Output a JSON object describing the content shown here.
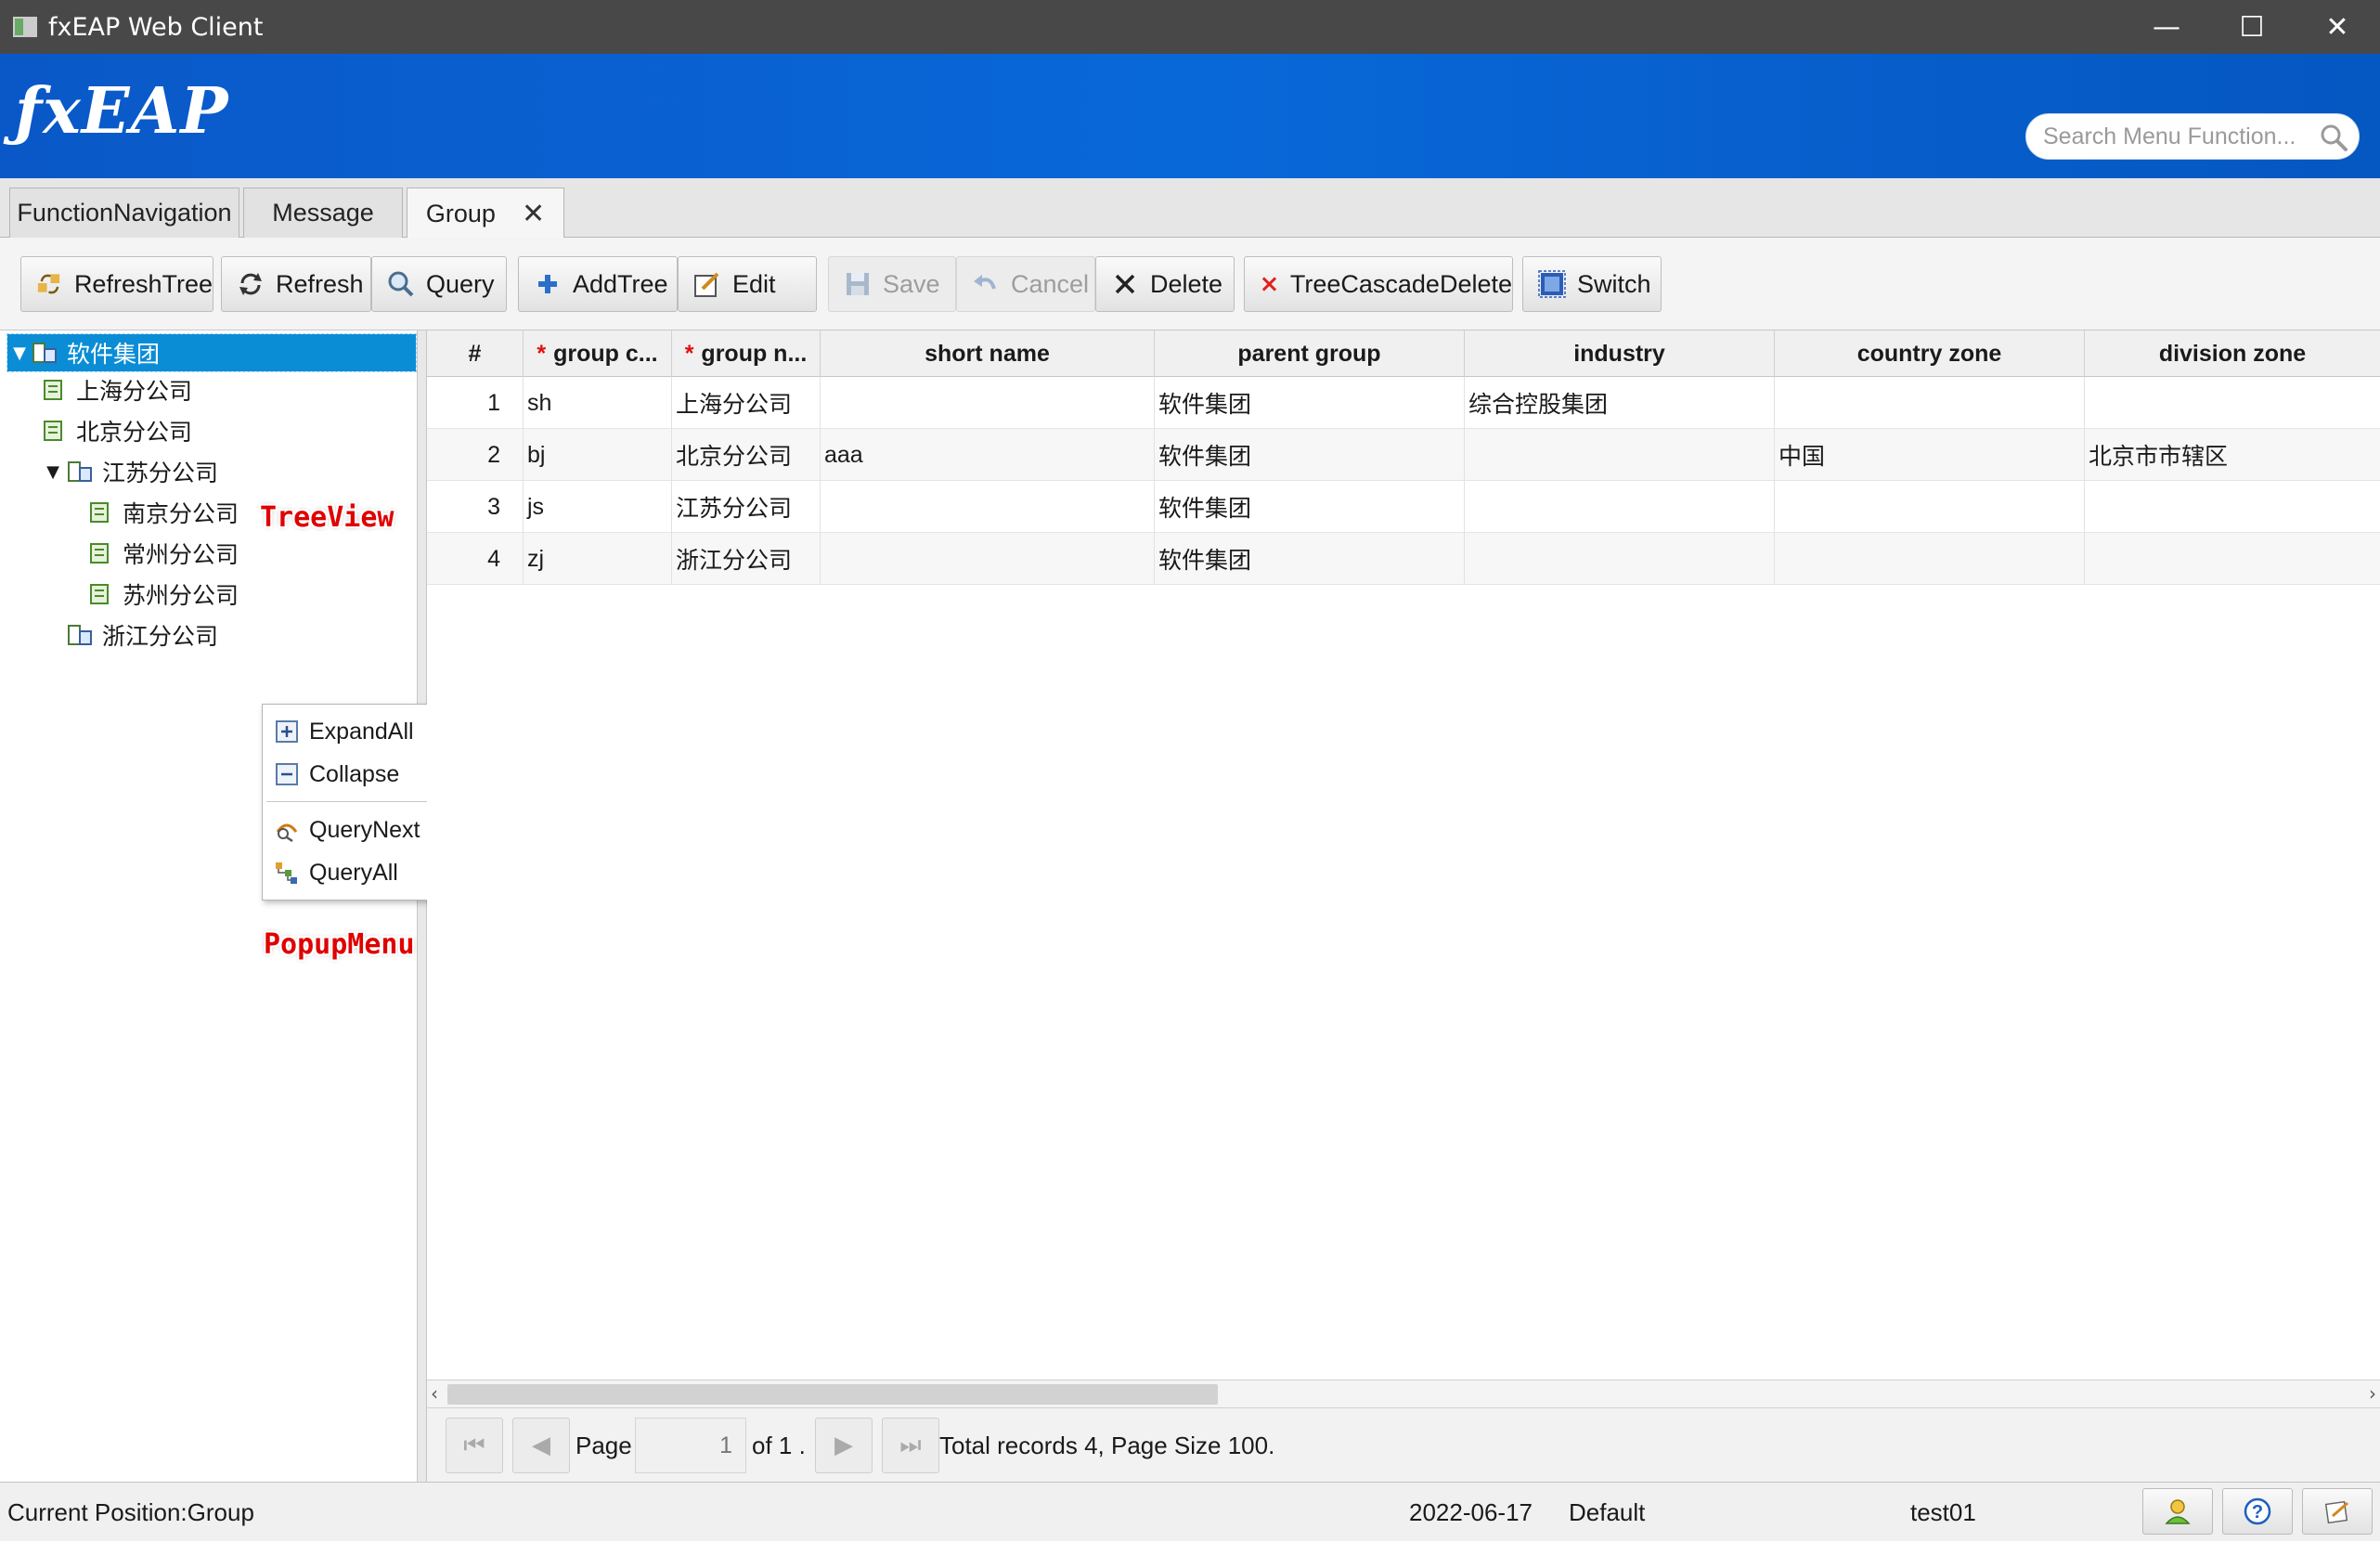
{
  "window": {
    "title": "fxEAP Web Client",
    "controls": [
      "—",
      "☐",
      "✕"
    ]
  },
  "header": {
    "logo": "ƒxEAP",
    "search": {
      "placeholder": "Search Menu Function...",
      "value": ""
    }
  },
  "tabs": [
    {
      "label": "FunctionNavigation"
    },
    {
      "label": "Message"
    },
    {
      "label": "Group",
      "active": true,
      "closable": true
    }
  ],
  "toolbar": {
    "refresh_tree": "RefreshTree",
    "refresh": "Refresh",
    "query": "Query",
    "add_tree": "AddTree",
    "edit": "Edit",
    "save": "Save",
    "cancel": "Cancel",
    "delete": "Delete",
    "tree_cascade_delete": "TreeCascadeDelete",
    "switch": "Switch"
  },
  "tree": {
    "nodes": [
      {
        "label": "软件集团",
        "level": 0,
        "expanded": true,
        "selected": true
      },
      {
        "label": "上海分公司",
        "level": 1
      },
      {
        "label": "北京分公司",
        "level": 1
      },
      {
        "label": "江苏分公司",
        "level": 1,
        "expanded": true
      },
      {
        "label": "南京分公司",
        "level": 2
      },
      {
        "label": "常州分公司",
        "level": 2
      },
      {
        "label": "苏州分公司",
        "level": 2
      },
      {
        "label": "浙江分公司",
        "level": 1
      }
    ],
    "annotation": "TreeView"
  },
  "popup_menu": {
    "items": [
      "ExpandAll",
      "Collapse",
      "QueryNext",
      "QueryAll"
    ],
    "annotation": "PopupMenu"
  },
  "grid": {
    "columns": [
      "#",
      "group c...",
      "group n...",
      "short name",
      "parent group",
      "industry",
      "country zone",
      "division zone"
    ],
    "rows": [
      [
        "1",
        "sh",
        "上海分公司",
        "",
        "软件集团",
        "综合控股集团",
        "",
        ""
      ],
      [
        "2",
        "bj",
        "北京分公司",
        "aaa",
        "软件集团",
        "",
        "中国",
        "北京市市辖区"
      ],
      [
        "3",
        "js",
        "江苏分公司",
        "",
        "软件集团",
        "",
        "",
        ""
      ],
      [
        "4",
        "zj",
        "浙江分公司",
        "",
        "软件集团",
        "",
        "",
        ""
      ]
    ]
  },
  "pager": {
    "page_label": "Page",
    "page_value": "1",
    "of_text": "of 1 .",
    "summary": "Total records  4, Page Size 100."
  },
  "status": {
    "position": "Current Position:Group",
    "date": "2022-06-17",
    "profile": "Default",
    "user": "test01"
  },
  "colors": {
    "banner": "#0a62d0",
    "selection": "#0b8dd6",
    "required": "#e01010"
  }
}
